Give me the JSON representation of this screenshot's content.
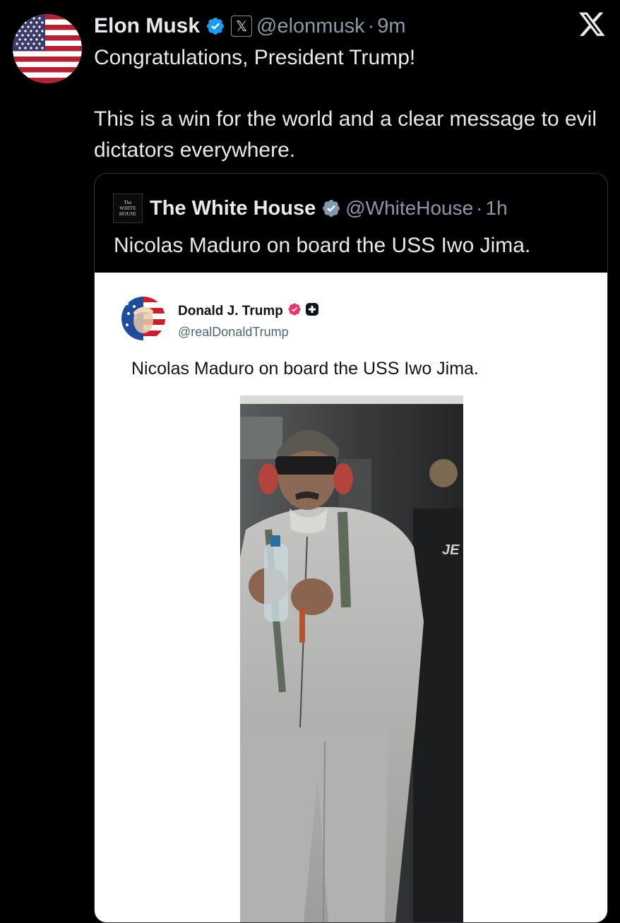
{
  "close_icon": "x-logo-icon",
  "tweet": {
    "avatar_icon": "us-flag-avatar",
    "author_name": "Elon Musk",
    "verified_icon": "verified-badge-icon",
    "affiliate_badge": "𝕏",
    "handle": "@elonmusk",
    "separator": "·",
    "time": "9m",
    "text_line1": "Congratulations, President Trump!",
    "text_line2": "This is a win for the world and a clear message to evil dictators everywhere."
  },
  "quoted": {
    "logo_lines": [
      "The",
      "WHITE",
      "HOUSE"
    ],
    "author_name": "The White House",
    "verified_icon": "verified-badge-gray-icon",
    "handle": "@WhiteHouse",
    "separator": "·",
    "time": "1h",
    "text": "Nicolas Maduro on board the USS Iwo Jima.",
    "embed": {
      "author_name": "Donald J. Trump",
      "handle": "@realDonaldTrump",
      "text": "Nicolas Maduro on board the USS Iwo Jima.",
      "badge_color": "#e8336d"
    }
  },
  "colors": {
    "background": "#000000",
    "primary_text": "#e7e9ea",
    "secondary_text": "#8b98a5",
    "verified_blue": "#1d9bf0",
    "embed_background": "#ffffff"
  }
}
